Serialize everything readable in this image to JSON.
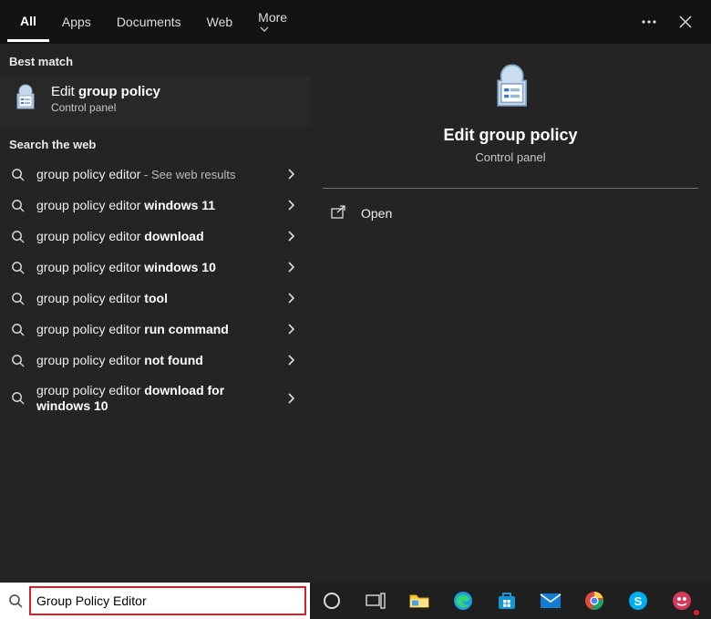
{
  "tabs": {
    "all": "All",
    "apps": "Apps",
    "documents": "Documents",
    "web": "Web",
    "more": "More"
  },
  "sections": {
    "best_match": "Best match",
    "search_web": "Search the web"
  },
  "best_match": {
    "title_prefix": "Edit ",
    "title_bold": "group policy",
    "subtitle": "Control panel"
  },
  "web_results": [
    {
      "base": "group policy editor",
      "suffix": "",
      "hint": " - See web results"
    },
    {
      "base": "group policy editor ",
      "suffix": "windows 11",
      "hint": ""
    },
    {
      "base": "group policy editor ",
      "suffix": "download",
      "hint": ""
    },
    {
      "base": "group policy editor ",
      "suffix": "windows 10",
      "hint": ""
    },
    {
      "base": "group policy editor ",
      "suffix": "tool",
      "hint": ""
    },
    {
      "base": "group policy editor ",
      "suffix": "run command",
      "hint": ""
    },
    {
      "base": "group policy editor ",
      "suffix": "not found",
      "hint": ""
    },
    {
      "base": "group policy editor ",
      "suffix": "download for windows 10",
      "hint": ""
    }
  ],
  "details": {
    "title": "Edit group policy",
    "subtitle": "Control panel",
    "actions": {
      "open": "Open"
    }
  },
  "search": {
    "value": "Group Policy Editor"
  },
  "taskbar_icons": [
    "cortana",
    "task-view",
    "file-explorer",
    "edge",
    "store",
    "mail",
    "chrome",
    "skype",
    "game"
  ]
}
